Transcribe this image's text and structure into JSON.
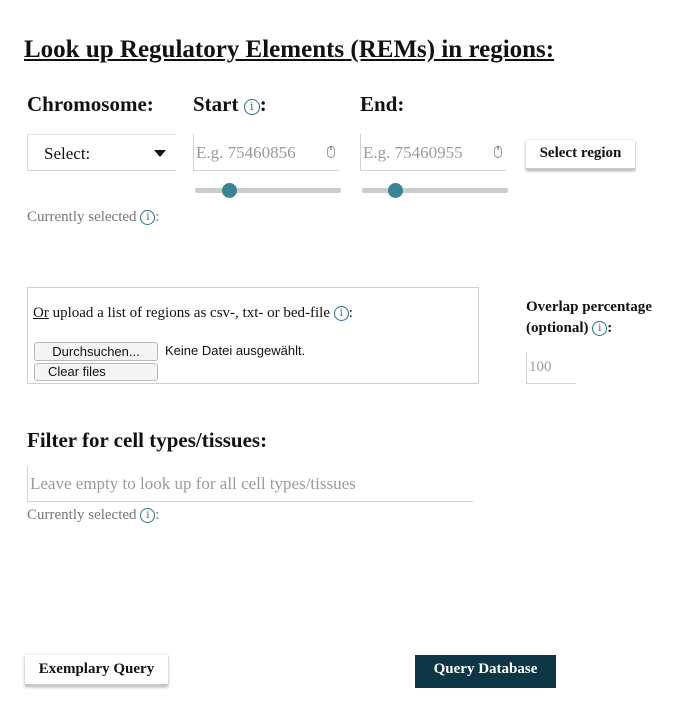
{
  "title": "Look up Regulatory Elements (REMs) in regions:",
  "info_glyph": "i",
  "region": {
    "chromosome_label": "Chromosome:",
    "start_label": "Start",
    "end_label": "End:",
    "colon": ":",
    "chromosome_selected": "Select:",
    "start_placeholder": "E.g. 75460856",
    "end_placeholder": "E.g. 75460955",
    "select_region_button": "Select region",
    "currently_selected": "Currently selected",
    "spinner_glyph": "⇕"
  },
  "upload": {
    "or_text": "Or",
    "text": " upload a list of regions as csv-, txt- or bed-file",
    "browse_button": "Durchsuchen...",
    "no_file_text": "Keine Datei ausgewählt.",
    "clear_button": "Clear files",
    "overlap_label_line1": "Overlap percentage",
    "overlap_label_line2": "(optional)",
    "overlap_placeholder": "100"
  },
  "filter": {
    "label": "Filter for cell types/tissues:",
    "placeholder": "Leave empty to look up for all cell types/tissues",
    "currently_selected": "Currently selected"
  },
  "footer": {
    "exemplary_button": "Exemplary Query",
    "query_button": "Query Database"
  },
  "colors": {
    "accent": "#3b8497",
    "primary_button": "#0d3747",
    "info_icon": "#2a6f86"
  }
}
